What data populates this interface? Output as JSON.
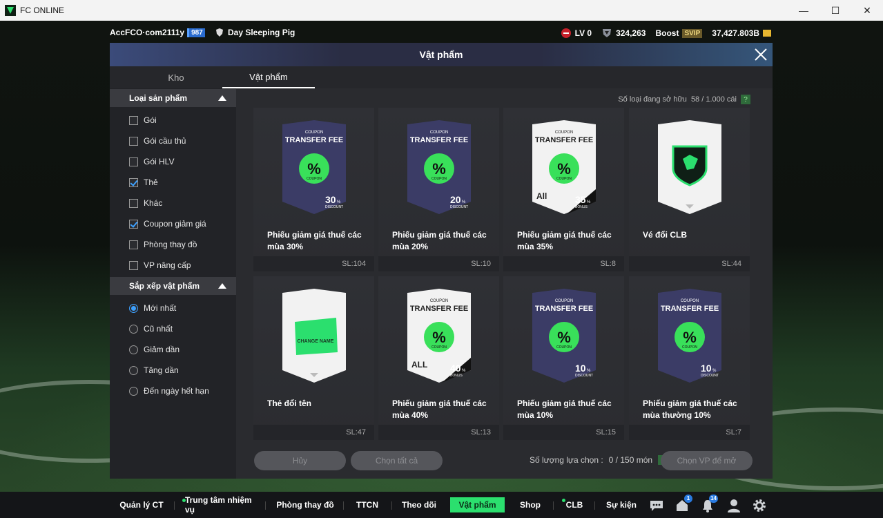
{
  "window": {
    "title": "FC ONLINE"
  },
  "status": {
    "account_name": "AccFCO·com2111y",
    "account_level": "987",
    "team_name": "Day Sleeping Pig",
    "lv": "LV 0",
    "points": "324,263",
    "boost": "Boost",
    "svip": "SVIP",
    "bp": "37,427.803B"
  },
  "modal": {
    "title": "Vật phẩm",
    "tabs": [
      {
        "label": "Kho"
      },
      {
        "label": "Vật phẩm"
      }
    ],
    "owned_label": "Số loại đang sở hữu",
    "owned_value": "58 / 1.000 cái",
    "help": "?",
    "filter": {
      "product_type_title": "Loại sản phẩm",
      "options": [
        {
          "label": "Gói",
          "checked": false
        },
        {
          "label": "Gói cầu thủ",
          "checked": false
        },
        {
          "label": "Gói HLV",
          "checked": false
        },
        {
          "label": "Thẻ",
          "checked": true
        },
        {
          "label": "Khác",
          "checked": false
        },
        {
          "label": "Coupon giảm giá",
          "checked": true
        },
        {
          "label": "Phòng thay đồ",
          "checked": false
        },
        {
          "label": "VP nâng cấp",
          "checked": false
        }
      ],
      "sort_title": "Sắp xếp vật phẩm",
      "sort_options": [
        {
          "label": "Mới nhất",
          "selected": true
        },
        {
          "label": "Cũ nhất",
          "selected": false
        },
        {
          "label": "Giảm dần",
          "selected": false
        },
        {
          "label": "Tăng dần",
          "selected": false
        },
        {
          "label": "Đến ngày hết hạn",
          "selected": false
        }
      ]
    },
    "items": [
      {
        "name": "Phiếu giảm giá thuế các mùa 30%",
        "qty": "SL:104",
        "art": "coupon-dark",
        "coupon_label": "COUPON",
        "coupon_title": "TRANSFER FEE",
        "percent": "30",
        "pct_sign": "%",
        "sub": "DISCOUNT",
        "class_label": ""
      },
      {
        "name": "Phiếu giảm giá thuế các mùa 20%",
        "qty": "SL:10",
        "art": "coupon-dark",
        "coupon_label": "COUPON",
        "coupon_title": "TRANSFER FEE",
        "percent": "20",
        "pct_sign": "%",
        "sub": "DISCOUNT",
        "class_label": ""
      },
      {
        "name": "Phiếu giảm giá thuế các mùa 35%",
        "qty": "SL:8",
        "art": "coupon-white",
        "coupon_label": "COUPON",
        "coupon_title": "TRANSFER FEE",
        "percent": "35",
        "pct_sign": "%",
        "sub": "BONUS",
        "class_label": "All"
      },
      {
        "name": "Vé đổi CLB",
        "qty": "SL:44",
        "art": "club-ticket"
      },
      {
        "name": "Thẻ đổi tên",
        "qty": "SL:47",
        "art": "change-name",
        "change_name": "CHANGE NAME"
      },
      {
        "name": "Phiếu giảm giá thuế các mùa 40%",
        "qty": "SL:13",
        "art": "coupon-white",
        "coupon_label": "COUPON",
        "coupon_title": "TRANSFER FEE",
        "percent": "40",
        "pct_sign": "%",
        "sub": "BONUS",
        "class_label": "ALL"
      },
      {
        "name": "Phiếu giảm giá thuế các mùa 10%",
        "qty": "SL:15",
        "art": "coupon-dark",
        "coupon_label": "COUPON",
        "coupon_title": "TRANSFER FEE",
        "percent": "10",
        "pct_sign": "%",
        "sub": "DISCOUNT",
        "class_label": ""
      },
      {
        "name": "Phiếu giảm giá thuế các mùa thường 10%",
        "qty": "SL:7",
        "art": "coupon-dark",
        "coupon_label": "COUPON",
        "coupon_title": "TRANSFER FEE",
        "percent": "10",
        "pct_sign": "%",
        "sub": "DISCOUNT",
        "class_label": ""
      }
    ],
    "buttons": {
      "cancel": "Hủy",
      "select_all": "Chọn tất cả",
      "selection_label": "Số lượng lựa chọn :",
      "selection_value": "0 / 150 món",
      "pick": "Chọn VP để mở"
    }
  },
  "nav": {
    "items": [
      {
        "label": "Quản lý CT",
        "dot": false
      },
      {
        "label": "Trung tâm nhiệm vụ",
        "dot": true
      },
      {
        "label": "Phòng thay đồ",
        "dot": false
      },
      {
        "label": "TTCN",
        "dot": false
      },
      {
        "label": "Theo dõi",
        "dot": false
      },
      {
        "label": "Vật phẩm",
        "dot": false,
        "active": true
      },
      {
        "label": "Shop",
        "dot": false
      },
      {
        "label": "CLB",
        "dot": true
      },
      {
        "label": "Sự kiện",
        "dot": false
      }
    ],
    "mail_badge": "1",
    "notif_badge": "14"
  },
  "colors": {
    "accent": "#2bdf6e",
    "check": "#3ca0ff",
    "coupon_green": "#39e05a"
  }
}
